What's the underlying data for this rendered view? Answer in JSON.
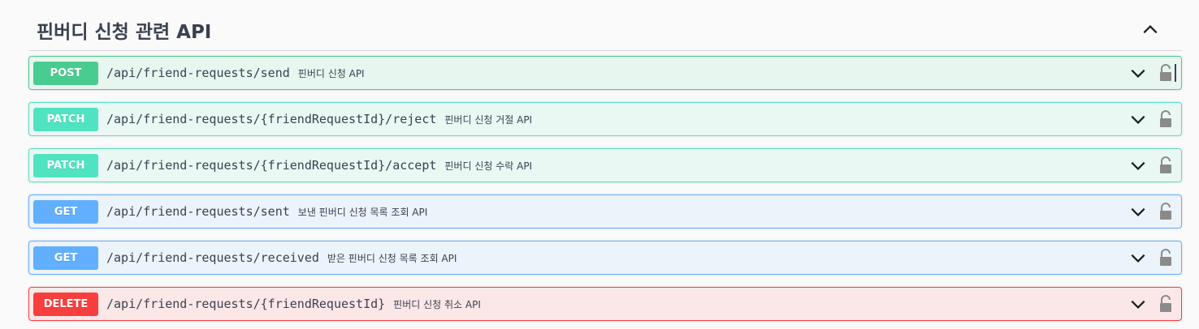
{
  "tag": {
    "title": "핀버디 신청 관련 API",
    "collapse_icon": "chevron-up-icon"
  },
  "operations": [
    {
      "method": "POST",
      "path": "/api/friend-requests/send",
      "summary": "핀버디 신청 API",
      "color": "#49cc90"
    },
    {
      "method": "PATCH",
      "path": "/api/friend-requests/{friendRequestId}/reject",
      "summary": "핀버디 신청 거절 API",
      "color": "#50e3c2"
    },
    {
      "method": "PATCH",
      "path": "/api/friend-requests/{friendRequestId}/accept",
      "summary": "핀버디 신청 수락 API",
      "color": "#50e3c2"
    },
    {
      "method": "GET",
      "path": "/api/friend-requests/sent",
      "summary": "보낸 핀버디 신청 목록 조회 API",
      "color": "#61affe"
    },
    {
      "method": "GET",
      "path": "/api/friend-requests/received",
      "summary": "받은 핀버디 신청 목록 조회 API",
      "color": "#61affe"
    },
    {
      "method": "DELETE",
      "path": "/api/friend-requests/{friendRequestId}",
      "summary": "핀버디 신청 취소 API",
      "color": "#f93e3e"
    }
  ],
  "icons": {
    "expand": "chevron-down-icon",
    "auth": "lock-icon"
  }
}
